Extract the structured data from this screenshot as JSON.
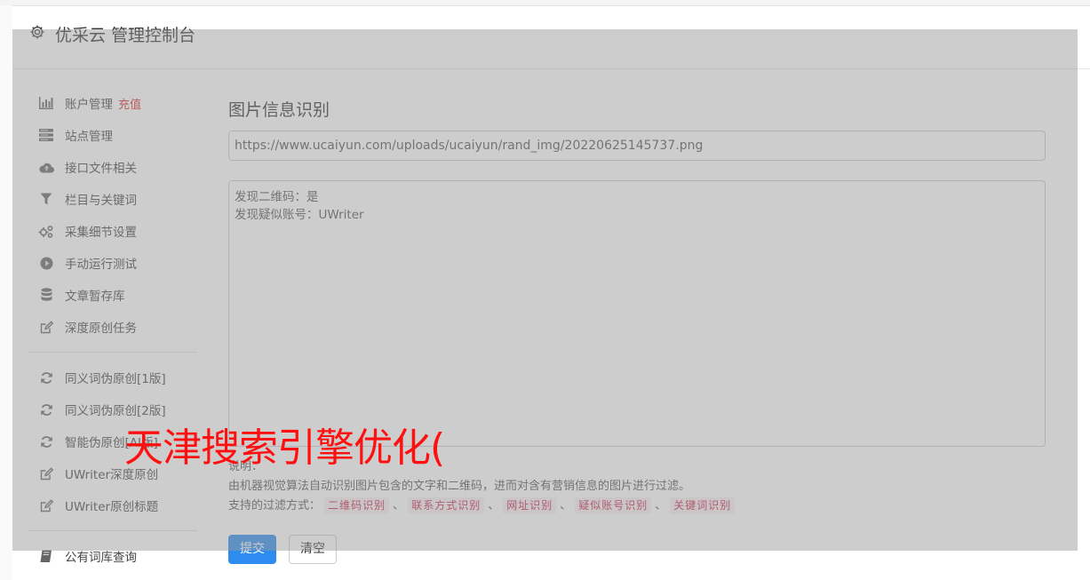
{
  "header": {
    "title": "优采云 管理控制台",
    "icon": "gear-icon"
  },
  "sidebar": {
    "group1": [
      {
        "label": "账户管理",
        "badge": "充值",
        "icon": "bar-chart-icon"
      },
      {
        "label": "站点管理",
        "icon": "server-icon"
      },
      {
        "label": "接口文件相关",
        "icon": "cloud-upload-icon"
      },
      {
        "label": "栏目与关键词",
        "icon": "filter-icon"
      },
      {
        "label": "采集细节设置",
        "icon": "cogs-icon"
      },
      {
        "label": "手动运行测试",
        "icon": "play-circle-icon"
      },
      {
        "label": "文章暂存库",
        "icon": "database-icon"
      },
      {
        "label": "深度原创任务",
        "icon": "edit-icon"
      }
    ],
    "group2": [
      {
        "label": "同义词伪原创[1版]",
        "icon": "refresh-icon"
      },
      {
        "label": "同义词伪原创[2版]",
        "icon": "refresh-icon"
      },
      {
        "label": "智能伪原创[AI版]",
        "icon": "refresh-icon"
      },
      {
        "label": "UWriter深度原创",
        "icon": "edit-icon"
      },
      {
        "label": "UWriter原创标题",
        "icon": "edit-icon"
      }
    ],
    "group3": [
      {
        "label": "公有词库查询",
        "icon": "book-icon"
      }
    ]
  },
  "main": {
    "heading": "图片信息识别",
    "url_value": "https://www.ucaiyun.com/uploads/ucaiyun/rand_img/20220625145737.png",
    "result_lines": [
      "发现二维码：是",
      "发现疑似账号：UWriter"
    ],
    "desc_title": "说明：",
    "desc_text": "由机器视觉算法自动识别图片包含的文字和二维码，进而对含有营销信息的图片进行过滤。",
    "filter_label": "支持的过滤方式：",
    "filters": [
      "二维码识别",
      "联系方式识别",
      "网址识别",
      "疑似账号识别",
      "关键词识别"
    ],
    "separator": "、",
    "submit_label": "提交",
    "clear_label": "清空"
  },
  "watermark": "天津搜索引擎优化(",
  "colors": {
    "accent": "#2d8cf0",
    "recharge": "#e02a2a",
    "tag_text": "#c7254e",
    "tag_bg": "#f9f2f4",
    "watermark": "#ff1010"
  }
}
